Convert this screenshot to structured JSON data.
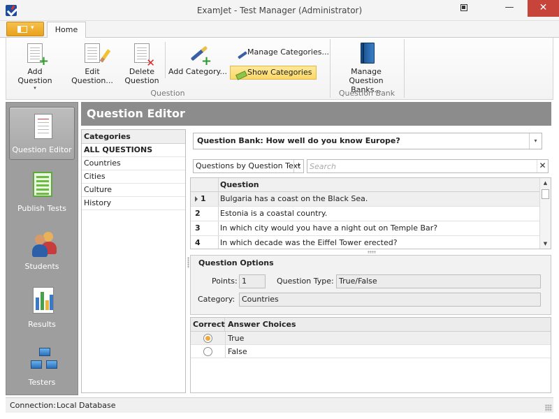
{
  "window": {
    "title": "ExamJet - Test Manager (Administrator)",
    "close_glyph": "✕",
    "minimize_glyph": "—"
  },
  "ribbon": {
    "tab_home": "Home",
    "buttons": {
      "add_question": "Add Question",
      "edit_question": "Edit Question...",
      "delete_question_1": "Delete",
      "delete_question_2": "Question",
      "add_category": "Add Category...",
      "manage_categories": "Manage Categories...",
      "show_categories": "Show Categories",
      "manage_banks_1": "Manage Question",
      "manage_banks_2": "Banks..."
    },
    "groups": {
      "question": "Question",
      "question_bank": "Question Bank"
    },
    "dropdown_glyph": "▾"
  },
  "nav": {
    "items": [
      {
        "label": "Question Editor",
        "icon": "document-icon",
        "selected": true
      },
      {
        "label": "Publish Tests",
        "icon": "publish-icon"
      },
      {
        "label": "Students",
        "icon": "students-icon"
      },
      {
        "label": "Results",
        "icon": "results-chart-icon"
      },
      {
        "label": "Testers",
        "icon": "network-computers-icon"
      }
    ]
  },
  "editor": {
    "title": "Question Editor"
  },
  "categories": {
    "header": "Categories",
    "items": [
      "ALL QUESTIONS",
      "Countries",
      "Cities",
      "Culture",
      "History"
    ]
  },
  "bank": {
    "selected": "Question Bank: How well do you know Europe?"
  },
  "filter": {
    "selected": "Questions by Question Text",
    "search_placeholder": "Search",
    "clear_glyph": "✕"
  },
  "questions": {
    "header": "Question",
    "rows": [
      {
        "num": "1",
        "text": "Bulgaria has a coast on the Black Sea."
      },
      {
        "num": "2",
        "text": "Estonia is a coastal country."
      },
      {
        "num": "3",
        "text": "In which city would you have a night out on Temple Bar?"
      },
      {
        "num": "4",
        "text": "In which decade was the Eiffel Tower erected?"
      }
    ]
  },
  "options": {
    "title": "Question Options",
    "points_label": "Points:",
    "points_value": "1",
    "type_label": "Question Type:",
    "type_value": "True/False",
    "category_label": "Category:",
    "category_value": "Countries"
  },
  "answers": {
    "header_correct": "Correct",
    "header_choices": "Answer Choices",
    "rows": [
      {
        "text": "True",
        "correct": true
      },
      {
        "text": "False",
        "correct": false
      }
    ]
  },
  "status": {
    "label": "Connection:",
    "value": "Local Database"
  },
  "colors": {
    "accent": "#f7c14a",
    "header_gray": "#8c8c8c",
    "nav_gray": "#9e9e9e",
    "close_red": "#c7443a"
  }
}
